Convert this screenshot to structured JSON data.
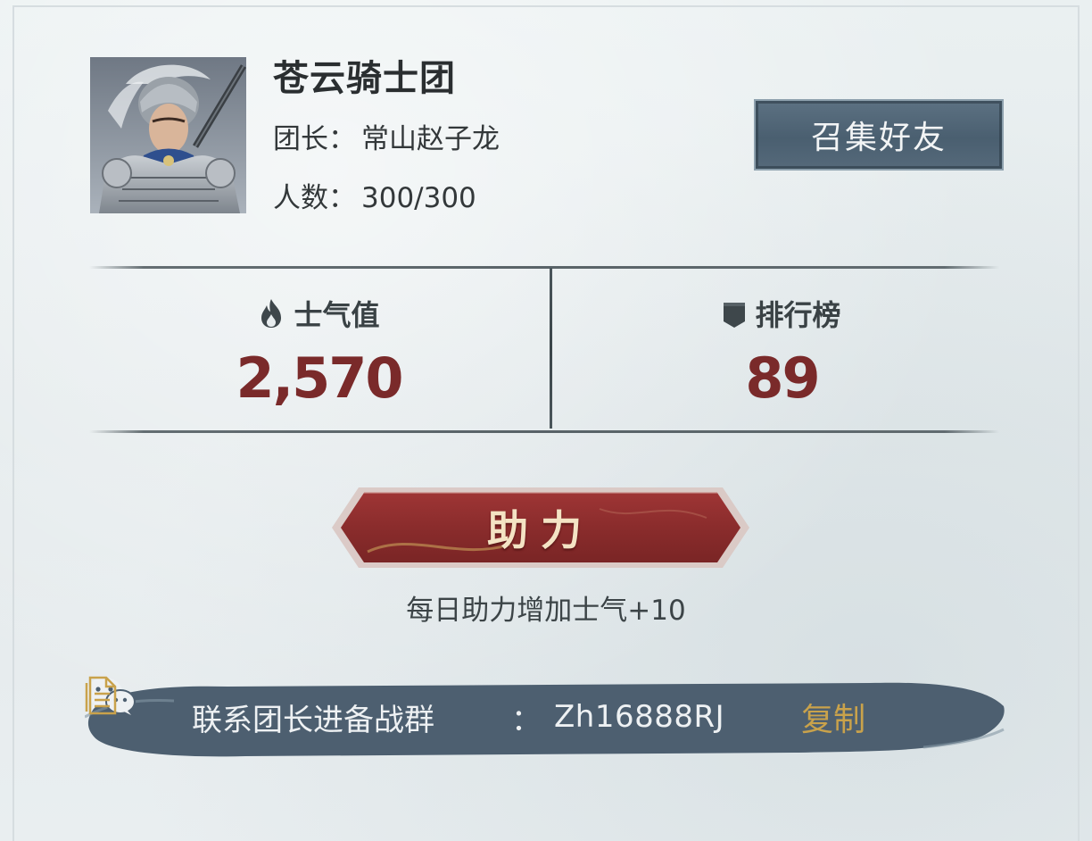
{
  "guild": {
    "name": "苍云骑士团",
    "leader_label": "团长：",
    "leader_name": "常山赵子龙",
    "members_label": "人数：",
    "members_value": "300/300"
  },
  "header": {
    "summon_label": "召集好友"
  },
  "stats": {
    "morale": {
      "label": "士气值",
      "value": "2,570",
      "icon": "flame-icon"
    },
    "ranking": {
      "label": "排行榜",
      "value": "89",
      "icon": "banner-icon"
    }
  },
  "assist": {
    "label": "助力",
    "hint": "每日助力增加士气+10"
  },
  "contact": {
    "text": "联系团长进备战群",
    "icon": "wechat-icon",
    "colon": "：",
    "wechat_id": "Zh16888RJ",
    "copy_label": "复制",
    "copy_icon": "document-icon"
  },
  "colors": {
    "accent_red": "#7a2a2a",
    "copy_gold": "#c9a24b",
    "band_blue": "#4d5f70"
  }
}
